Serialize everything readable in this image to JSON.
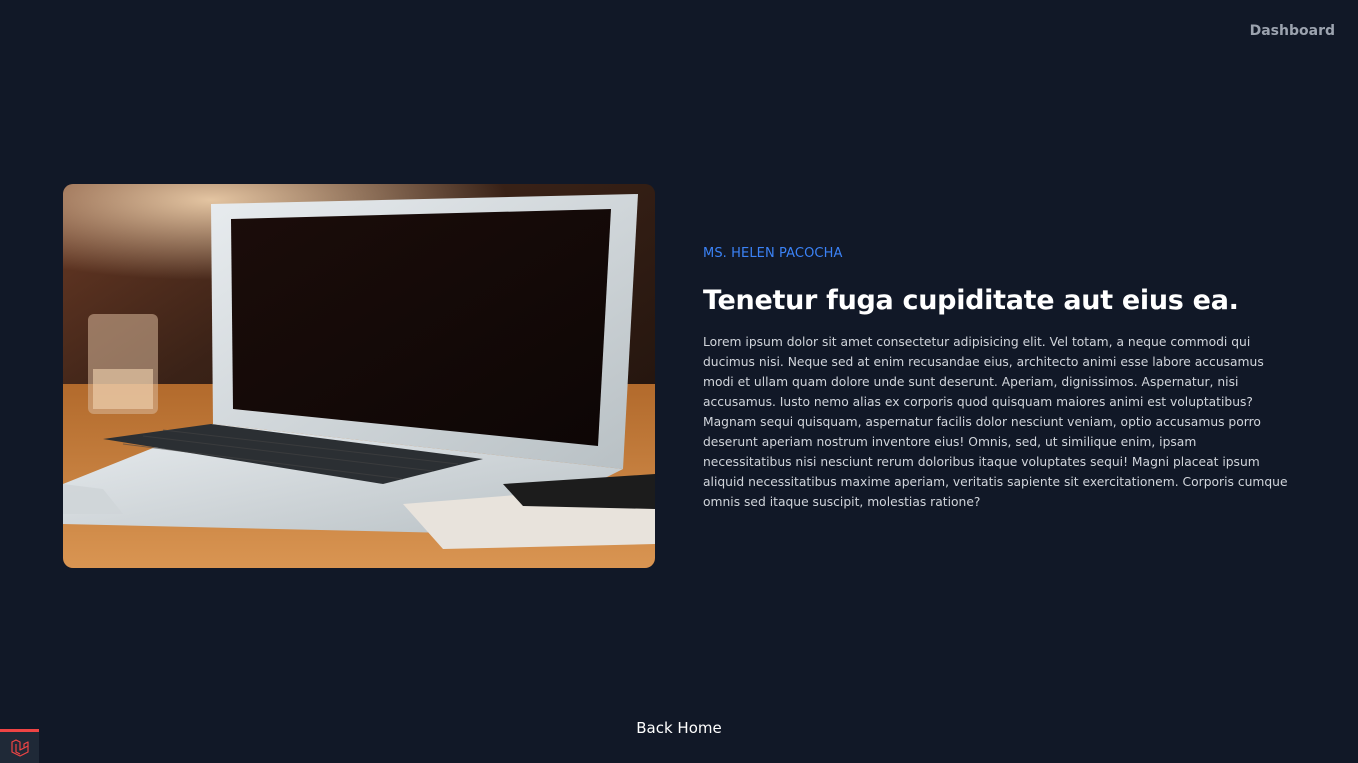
{
  "nav": {
    "dashboard_label": "Dashboard"
  },
  "post": {
    "image_icon": "laptop-photo",
    "author": "Ms. Helen Pacocha",
    "title": "Tenetur fuga cupiditate aut eius ea.",
    "body": "Lorem ipsum dolor sit amet consectetur adipisicing elit. Vel totam, a neque commodi qui ducimus nisi. Neque sed at enim recusandae eius, architecto animi esse labore accusamus modi et ullam quam dolore unde sunt deserunt. Aperiam, dignissimos. Aspernatur, nisi accusamus. Iusto nemo alias ex corporis quod quisquam maiores animi est voluptatibus? Magnam sequi quisquam, aspernatur facilis dolor nesciunt veniam, optio accusamus porro deserunt aperiam nostrum inventore eius! Omnis, sed, ut similique enim, ipsam necessitatibus nisi nesciunt rerum doloribus itaque voluptates sequi! Magni placeat ipsum aliquid necessitatibus maxime aperiam, veritatis sapiente sit exercitationem. Corporis cumque omnis sed itaque suscipit, molestias ratione?"
  },
  "footer": {
    "back_home_label": "Back Home"
  },
  "debugbar": {
    "icon": "laravel-logo-icon"
  },
  "colors": {
    "background": "#111827",
    "author": "#3b82f6",
    "title": "#ffffff",
    "body": "#d1d5db",
    "nav": "#9ca3af",
    "debug_accent": "#ef4444"
  }
}
